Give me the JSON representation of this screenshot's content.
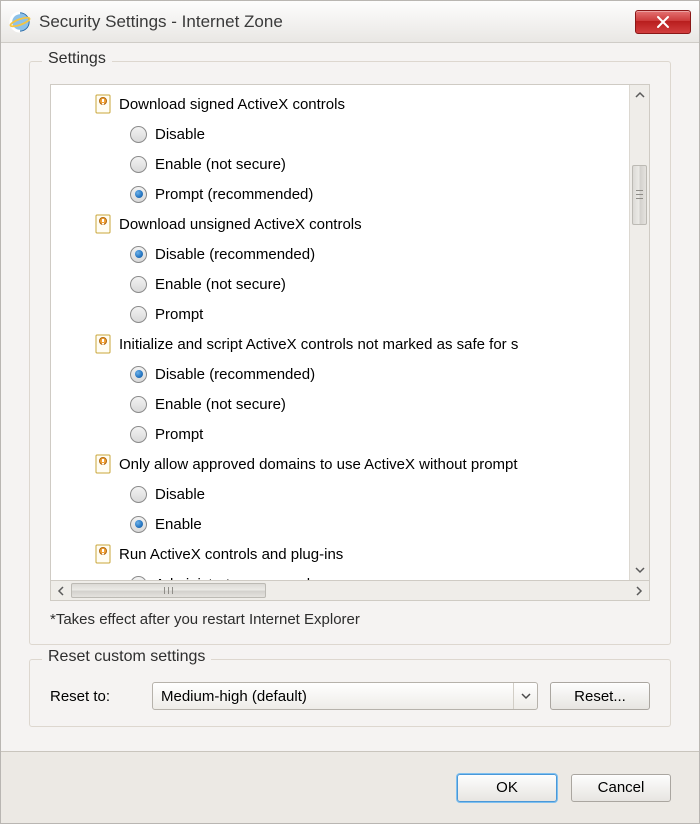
{
  "window": {
    "title": "Security Settings - Internet Zone"
  },
  "groups": {
    "settings_label": "Settings",
    "reset_label": "Reset custom settings"
  },
  "settings_list": {
    "categories": [
      {
        "label": "Download signed ActiveX controls",
        "options": [
          {
            "label": "Disable",
            "selected": false
          },
          {
            "label": "Enable (not secure)",
            "selected": false
          },
          {
            "label": "Prompt (recommended)",
            "selected": true
          }
        ]
      },
      {
        "label": "Download unsigned ActiveX controls",
        "options": [
          {
            "label": "Disable (recommended)",
            "selected": true
          },
          {
            "label": "Enable (not secure)",
            "selected": false
          },
          {
            "label": "Prompt",
            "selected": false
          }
        ]
      },
      {
        "label": "Initialize and script ActiveX controls not marked as safe for s",
        "options": [
          {
            "label": "Disable (recommended)",
            "selected": true
          },
          {
            "label": "Enable (not secure)",
            "selected": false
          },
          {
            "label": "Prompt",
            "selected": false
          }
        ]
      },
      {
        "label": "Only allow approved domains to use ActiveX without prompt",
        "options": [
          {
            "label": "Disable",
            "selected": false
          },
          {
            "label": "Enable",
            "selected": true
          }
        ]
      },
      {
        "label": "Run ActiveX controls and plug-ins",
        "options": [
          {
            "label": "Administrator approved",
            "selected": false
          }
        ]
      }
    ]
  },
  "note_text": "*Takes effect after you restart Internet Explorer",
  "reset": {
    "to_label": "Reset to:",
    "selected": "Medium-high (default)",
    "button": "Reset..."
  },
  "footer": {
    "ok": "OK",
    "cancel": "Cancel"
  }
}
